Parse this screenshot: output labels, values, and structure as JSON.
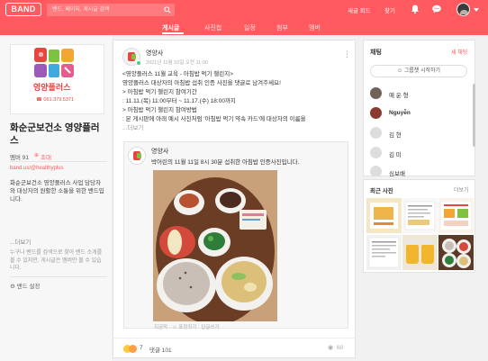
{
  "header": {
    "logo": "BAND",
    "search_placeholder": "밴드, 페이지, 게시글 검색",
    "new_feed": "새글 피드",
    "find": "찾기"
  },
  "tabs": [
    {
      "label": "게시글",
      "active": true
    },
    {
      "label": "사진첩",
      "active": false
    },
    {
      "label": "일정",
      "active": false
    },
    {
      "label": "첨부",
      "active": false
    },
    {
      "label": "멤버",
      "active": false
    }
  ],
  "sidebar": {
    "cover_brand": "영양플러스",
    "cover_phone": "☎ 061.379.5371",
    "band_name": "화순군보건소 영양플러스",
    "members_label": "멤버 91",
    "invite_label": "초대",
    "band_url": "band.us/@healthyplus",
    "description": "화순군보건소 영양플러스 사업 담당자와 대상자의 원활한 소통을 위한 밴드입니다.",
    "more": "...더보기",
    "note": "누구나 밴드를 검색으로 찾아 밴드 소개를 볼 수 있지만, 게시글은 멤버만 볼 수 있습니다.",
    "settings": "밴드 설정"
  },
  "post": {
    "author": "영양사",
    "date": "2021년 11월 10일 오전 11:00",
    "body_lines": [
      "<영양플러스 11월 교육 - 아침밥 먹기 챌린지>",
      "영양플러스 대상자의 아침밥 섭취 인증 사진을 댓글로 남겨주세요!",
      "> 아침밥 먹기 챌린지 참여기간",
      ": 11.11.(목) 11:00부터 ~ 11.17.(수) 18:00까지",
      "> 아침밥 먹기 챌린지 참여방법",
      ": 본 게시판에 아래 예시 사진처럼 '아침밥 먹기 약속 카드'에 대상자의 이름을"
    ],
    "body_more": "...더보기",
    "shared": {
      "author": "영양사",
      "text": "박어린의 11월 11일 8시 30분 섭취한 아침밥 인증사진입니다.",
      "stats": "지금막 · ☺ 표정짓기 · 답글쓰기"
    },
    "reactions": "7",
    "comments": "댓글 101",
    "views": "60"
  },
  "chat": {
    "title": "채팅",
    "new_chat": "새 채팅",
    "start_group": "그룹챗 시작하기",
    "members": [
      {
        "name": "예 운 형"
      },
      {
        "name": "Nguyễn"
      },
      {
        "name": "김 현"
      },
      {
        "name": "김 미"
      },
      {
        "name": "심보배"
      }
    ]
  },
  "photos": {
    "title": "최근 사진",
    "more": "더보기"
  },
  "colors": {
    "brand": "#ff5a5f",
    "background": "#f1f1f1"
  }
}
